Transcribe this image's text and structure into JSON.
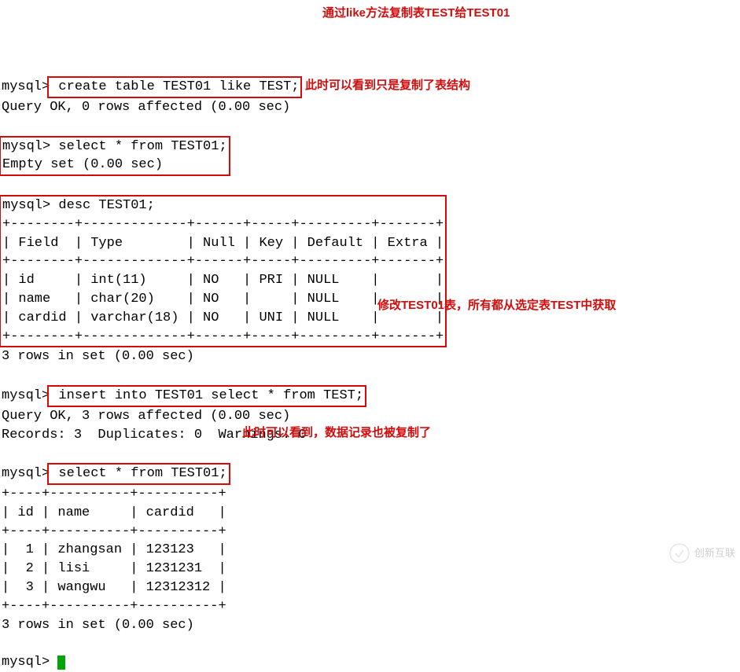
{
  "prompt": "mysql>",
  "commands": {
    "create": " create table TEST01 like TEST;",
    "create_result": "Query OK, 0 rows affected (0.00 sec)",
    "select1": " select * from TEST01;",
    "select1_result": "Empty set (0.00 sec)",
    "desc": " desc TEST01;",
    "desc_table": "+--------+-------------+------+-----+---------+-------+\n| Field  | Type        | Null | Key | Default | Extra |\n+--------+-------------+------+-----+---------+-------+\n| id     | int(11)     | NO   | PRI | NULL    |       |\n| name   | char(20)    | NO   |     | NULL    |       |\n| cardid | varchar(18) | NO   | UNI | NULL    |       |\n+--------+-------------+------+-----+---------+-------+",
    "desc_result": "3 rows in set (0.00 sec)",
    "insert": " insert into TEST01 select * from TEST;",
    "insert_result1": "Query OK, 3 rows affected (0.00 sec)",
    "insert_result2": "Records: 3  Duplicates: 0  Warnings: 0",
    "select2": " select * from TEST01;",
    "select2_table": "+----+----------+----------+\n| id | name     | cardid   |\n+----+----------+----------+\n|  1 | zhangsan | 123123   |\n|  2 | lisi     | 1231231  |\n|  3 | wangwu   | 12312312 |\n+----+----------+----------+",
    "select2_result": "3 rows in set (0.00 sec)"
  },
  "annotations": {
    "a1": "通过like方法复制表TEST给TEST01",
    "a2": "此时可以看到只是复制了表结构",
    "a3": "修改TEST01表，所有都从选定表TEST中获取",
    "a4": "此时可以看到，数据记录也被复制了"
  },
  "watermark": "创新互联"
}
